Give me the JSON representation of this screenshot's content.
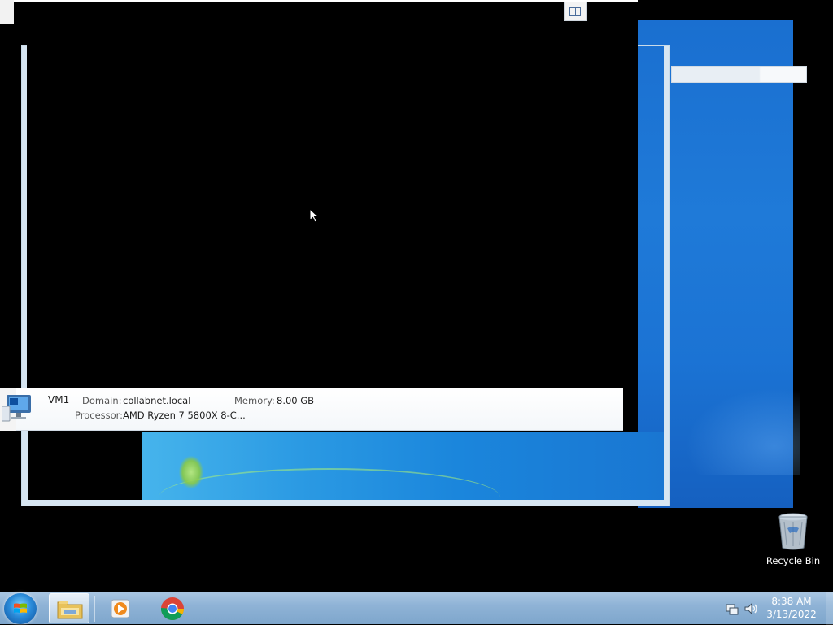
{
  "vm_details": {
    "name": "VM1",
    "domain_label": "Domain:",
    "domain_value": "collabnet.local",
    "memory_label": "Memory:",
    "memory_value": "8.00 GB",
    "processor_label": "Processor:",
    "processor_value": "AMD Ryzen 7 5800X 8-C..."
  },
  "desktop": {
    "recycle_bin_label": "Recycle Bin"
  },
  "taskbar": {
    "apps": [
      {
        "name": "windows-explorer",
        "icon": "folder-icon",
        "active": true
      },
      {
        "name": "media-player",
        "icon": "media-player-icon",
        "active": false
      },
      {
        "name": "chrome",
        "icon": "chrome-icon",
        "active": false
      }
    ],
    "clock_time": "8:38 AM",
    "clock_date": "3/13/2022"
  },
  "colors": {
    "taskbar": "#8fb3d6",
    "wallpaper": "#1b73d4",
    "vm_screen": "#000000"
  }
}
